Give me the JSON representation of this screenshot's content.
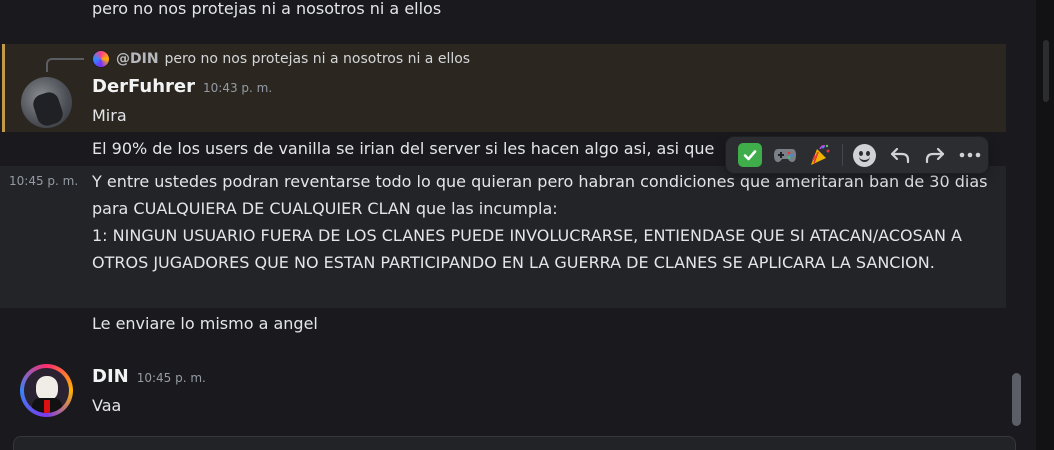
{
  "messages": {
    "top_line": "pero no nos protejas ni a nosotros ni a ellos",
    "reply": {
      "mention": "@DIN",
      "text": "pero no nos protejas ni a nosotros ni a ellos"
    },
    "derfuhrer": {
      "author": "DerFuhrer",
      "timestamp": "10:43 p. m.",
      "text": "Mira"
    },
    "line_90": "El 90% de los users de vanilla se irian del server si les hacen algo asi, asi que",
    "hovered": {
      "side_timestamp": "10:45 p. m.",
      "text": "Y entre ustedes podran reventarse todo lo que quieran pero habran condiciones que ameritaran ban de 30 dias para CUALQUIERA DE CUALQUIER CLAN que las incumpla:\n1: NINGUN USUARIO FUERA DE LOS CLANES PUEDE INVOLUCRARSE, ENTIENDASE QUE SI ATACAN/ACOSAN A OTROS JUGADORES QUE NO ESTAN PARTICIPANDO EN LA GUERRA DE CLANES SE APLICARA LA SANCION."
    },
    "angel_line": "Le enviare lo mismo a angel",
    "din": {
      "author": "DIN",
      "timestamp": "10:45 p. m.",
      "text": "Vaa"
    }
  },
  "toolbar": {
    "reactions": [
      "✅",
      "🎮",
      "🎉"
    ],
    "icons": [
      "add-reaction-icon",
      "reply-icon",
      "forward-icon",
      "more-icon"
    ],
    "more_glyph": "⋯",
    "reply_glyph": "↶",
    "forward_glyph": "↷"
  },
  "colors": {
    "background": "#1a1a1e",
    "highlight": "#2b2720",
    "highlight_bar": "#c29a4b",
    "hover": "#232428",
    "check": "#3fae4a"
  }
}
